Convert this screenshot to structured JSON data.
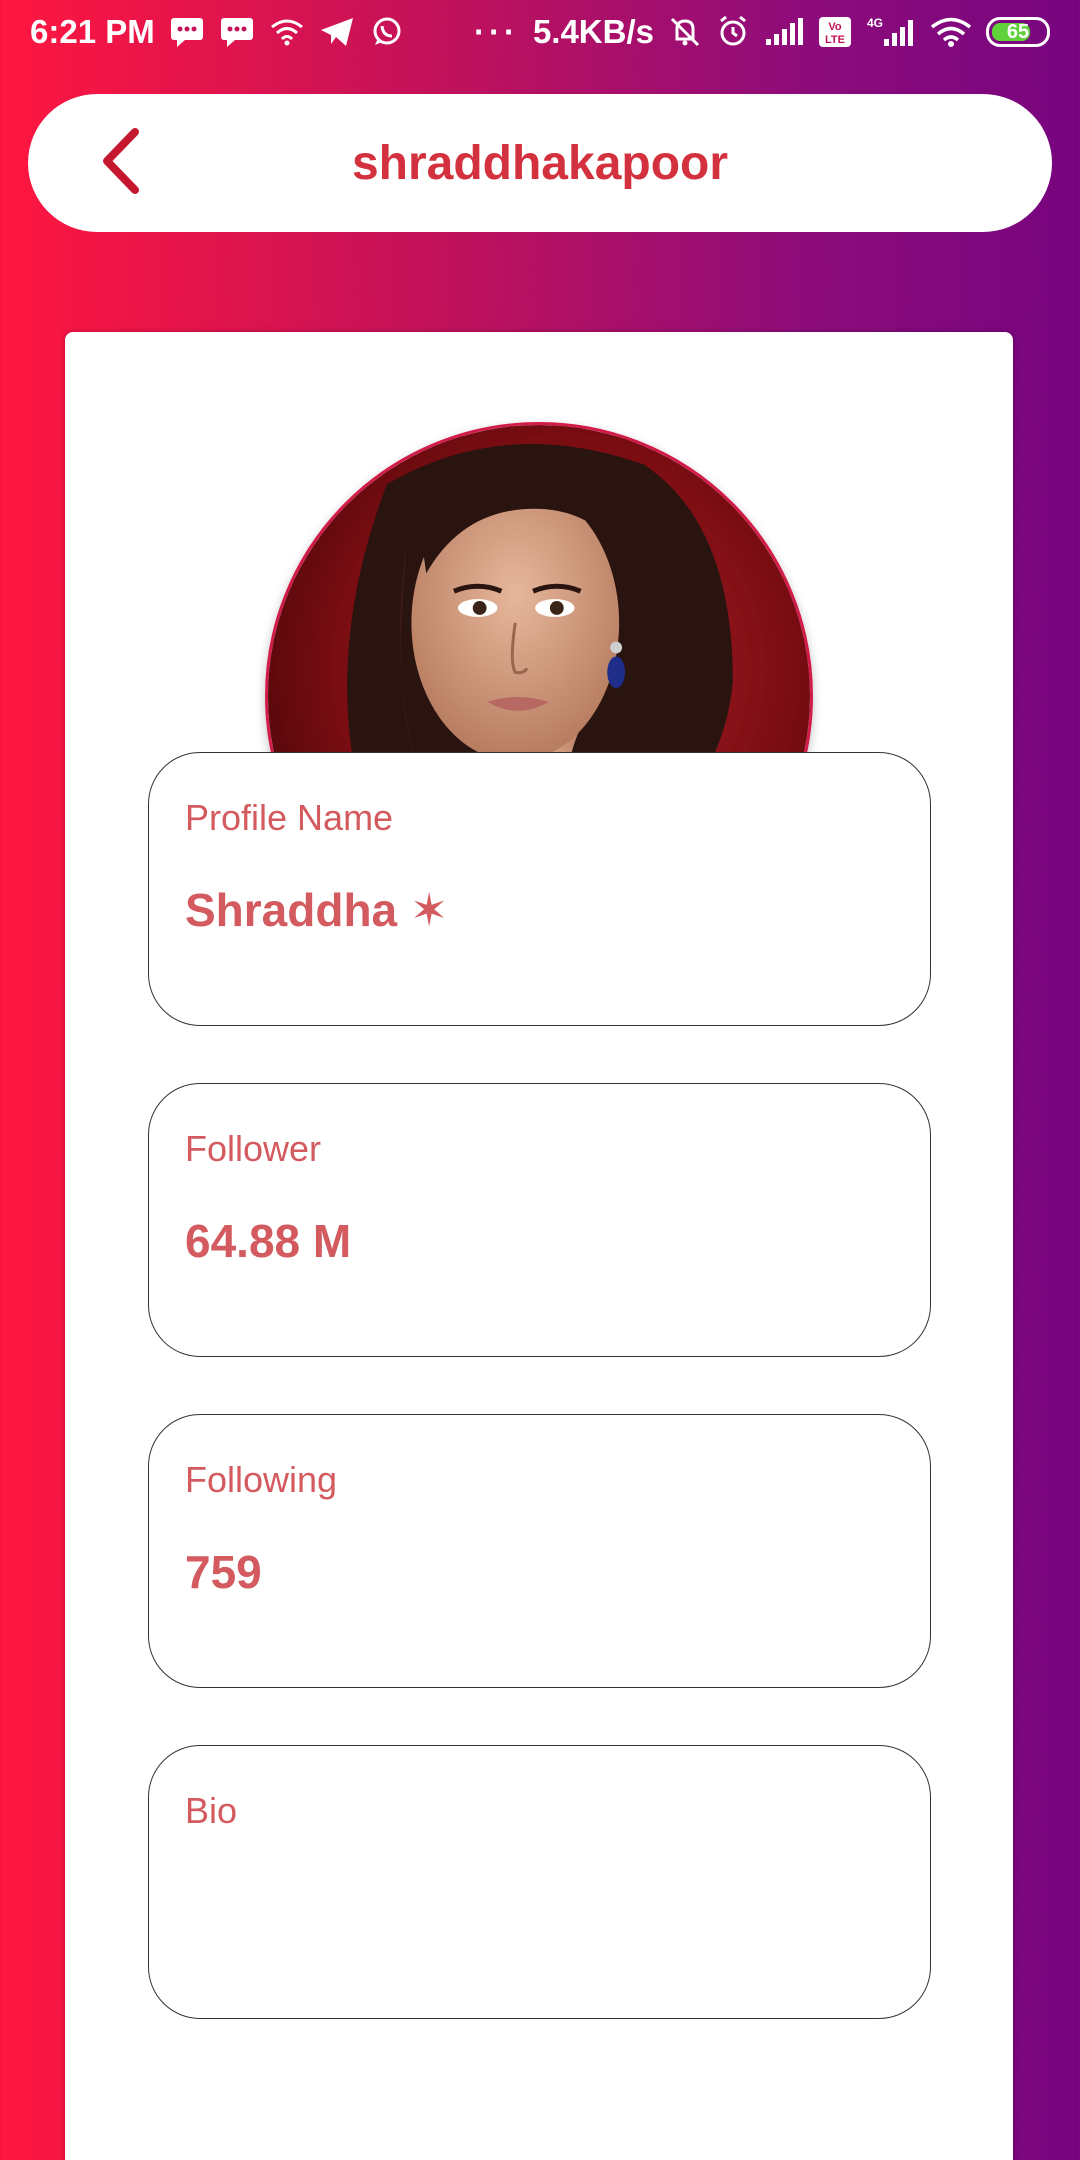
{
  "status_bar": {
    "time": "6:21 PM",
    "speed": "5.4KB/s",
    "battery": "65",
    "network": "4G",
    "lte": "Vo LTE"
  },
  "header": {
    "title": "shraddhakapoor",
    "back_icon": "chevron-left-icon"
  },
  "profile": {
    "avatar_icon": "profile-photo"
  },
  "fields": [
    {
      "label": "Profile Name",
      "value": "Shraddha ✶"
    },
    {
      "label": "Follower",
      "value": "64.88 M"
    },
    {
      "label": "Following",
      "value": "759"
    },
    {
      "label": "Bio",
      "value": ""
    }
  ],
  "colors": {
    "accent": "#d4313e",
    "field_text": "#d35a5f",
    "gradient_start": "#ff163f",
    "gradient_end": "#77047f"
  }
}
